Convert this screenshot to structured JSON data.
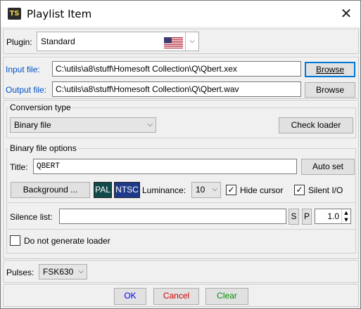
{
  "window": {
    "title": "Playlist Item",
    "app_icon": "TS"
  },
  "plugin": {
    "label": "Plugin:",
    "value": "Standard",
    "flag_icon": "us-flag-icon"
  },
  "input_file": {
    "label": "Input file:",
    "value": "C:\\utils\\a8\\stuff\\Homesoft Collection\\Q\\Qbert.xex",
    "browse": "Browse"
  },
  "output_file": {
    "label": "Output file:",
    "value": "C:\\utils\\a8\\stuff\\Homesoft Collection\\Q\\Qbert.wav",
    "browse": "Browse"
  },
  "conversion": {
    "legend": "Conversion type",
    "type": "Binary file",
    "check_loader": "Check loader"
  },
  "binary_options": {
    "legend": "Binary file options",
    "title_label": "Title:",
    "title_value": "QBERT",
    "auto_set": "Auto set",
    "background": "Background ...",
    "pal": "PAL",
    "ntsc": "NTSC",
    "luminance_label": "Luminance:",
    "luminance_value": "10",
    "hide_cursor": "Hide cursor",
    "silent_io": "Silent I/O"
  },
  "silence": {
    "label": "Silence list:",
    "value": "",
    "s": "S",
    "p": "P",
    "number": "1.0"
  },
  "no_loader": {
    "label": "Do not generate loader",
    "checked": false
  },
  "pulses": {
    "label": "Pulses:",
    "value": "FSK630"
  },
  "footer": {
    "ok": "OK",
    "cancel": "Cancel",
    "clear": "Clear"
  },
  "colors": {
    "ok": "#0000ff",
    "cancel": "#d00000",
    "clear": "#009000",
    "pal_bg": "#114a4a",
    "ntsc_bg": "#1f3a8a",
    "focus": "#0078d7"
  }
}
